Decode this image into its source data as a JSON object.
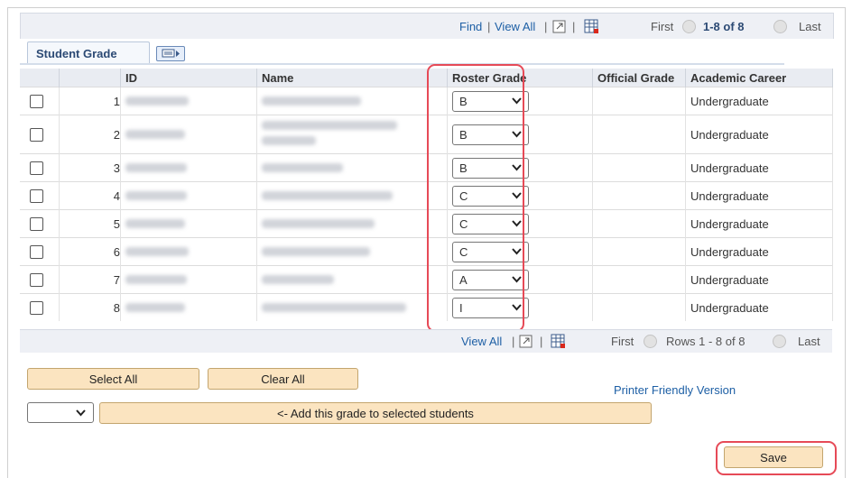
{
  "nav_top": {
    "find": "Find",
    "view_all": "View All",
    "first": "First",
    "range": "1-8 of 8",
    "last": "Last"
  },
  "tab": {
    "label": "Student Grade"
  },
  "columns": [
    "ID",
    "Name",
    "Roster Grade",
    "Official Grade",
    "Academic Career"
  ],
  "rows": [
    {
      "num": "1",
      "grade": "B",
      "career": "Undergraduate"
    },
    {
      "num": "2",
      "grade": "B",
      "career": "Undergraduate"
    },
    {
      "num": "3",
      "grade": "B",
      "career": "Undergraduate"
    },
    {
      "num": "4",
      "grade": "C",
      "career": "Undergraduate"
    },
    {
      "num": "5",
      "grade": "C",
      "career": "Undergraduate"
    },
    {
      "num": "6",
      "grade": "C",
      "career": "Undergraduate"
    },
    {
      "num": "7",
      "grade": "A",
      "career": "Undergraduate"
    },
    {
      "num": "8",
      "grade": "I",
      "career": "Undergraduate"
    }
  ],
  "nav_bottom": {
    "view_all": "View All",
    "first": "First",
    "range": "Rows 1 - 8 of 8",
    "last": "Last"
  },
  "buttons": {
    "select_all": "Select All",
    "clear_all": "Clear All",
    "add_grade": "<- Add this grade to selected students",
    "save": "Save"
  },
  "printer_link": "Printer Friendly Version",
  "colors": {
    "highlight": "#e64a57",
    "button_bg": "#fbe4c0",
    "link": "#1d5fa5"
  }
}
